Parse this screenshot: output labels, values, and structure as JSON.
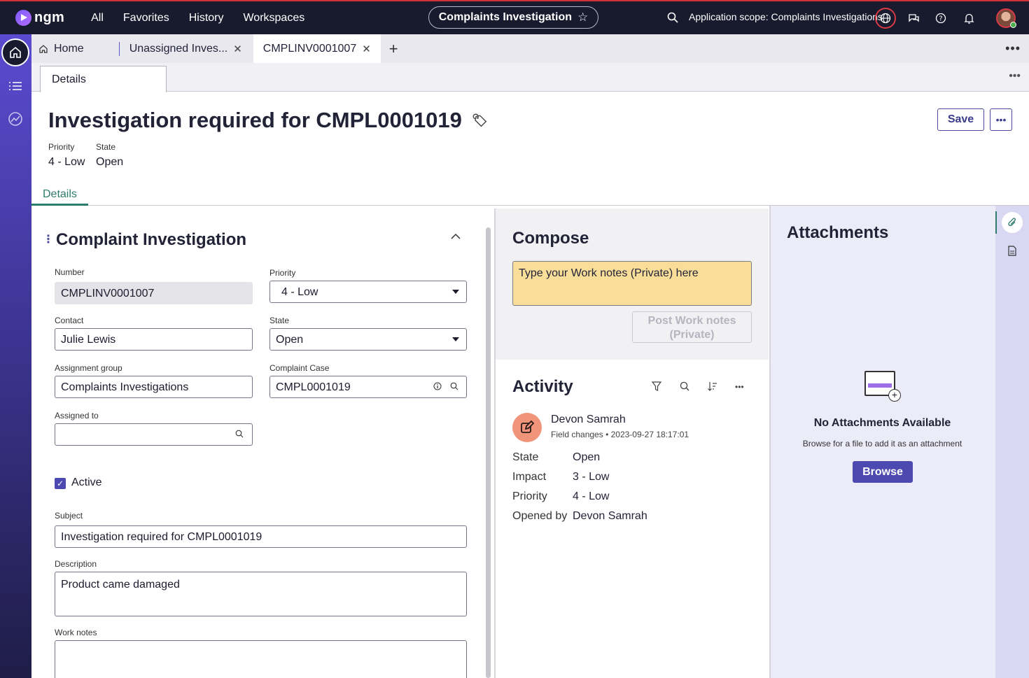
{
  "app": {
    "logo_text": "ngm",
    "nav_links": [
      "All",
      "Favorites",
      "History",
      "Workspaces"
    ],
    "workspace_pill": "Complaints Investigation",
    "scope_text": "Application scope: Complaints Investigations"
  },
  "tabs": {
    "home": "Home",
    "unassigned": "Unassigned Inves...",
    "record": "CMPLINV0001007"
  },
  "subtabs": {
    "details": "Details"
  },
  "record": {
    "title": "Investigation required for CMPL0001019",
    "priority_label": "Priority",
    "priority_value": "4 - Low",
    "state_label": "State",
    "state_value": "Open",
    "save_label": "Save",
    "content_tab": "Details"
  },
  "form": {
    "section_title": "Complaint Investigation",
    "number_label": "Number",
    "number_value": "CMPLINV0001007",
    "priority_label": "Priority",
    "priority_value": "4 - Low",
    "contact_label": "Contact",
    "contact_value": "Julie Lewis",
    "state_label": "State",
    "state_value": "Open",
    "assignment_group_label": "Assignment group",
    "assignment_group_value": "Complaints Investigations",
    "complaint_case_label": "Complaint Case",
    "complaint_case_value": "CMPL0001019",
    "assigned_to_label": "Assigned to",
    "assigned_to_value": "",
    "active_label": "Active",
    "subject_label": "Subject",
    "subject_value": "Investigation required for CMPL0001019",
    "description_label": "Description",
    "description_value": "Product came damaged",
    "work_notes_label": "Work notes",
    "work_notes_value": ""
  },
  "compose": {
    "title": "Compose",
    "placeholder": "Type your Work notes (Private) here",
    "post_label_1": "Post Work notes",
    "post_label_2": "(Private)"
  },
  "activity": {
    "title": "Activity",
    "author": "Devon Samrah",
    "type": "Field changes",
    "timestamp": "2023-09-27 18:17:01",
    "rows": [
      {
        "key": "State",
        "value": "Open"
      },
      {
        "key": "Impact",
        "value": "3 - Low"
      },
      {
        "key": "Priority",
        "value": "4 - Low"
      },
      {
        "key": "Opened by",
        "value": "Devon Samrah"
      }
    ]
  },
  "attachments": {
    "title": "Attachments",
    "empty_title": "No Attachments Available",
    "hint": "Browse for a file to add it as an attachment",
    "browse_label": "Browse"
  },
  "colors": {
    "nav_bg": "#181a2e",
    "accent": "#4c4ab0",
    "compose_bg": "#f9de9a",
    "tab_active": "#2e7d6b"
  }
}
